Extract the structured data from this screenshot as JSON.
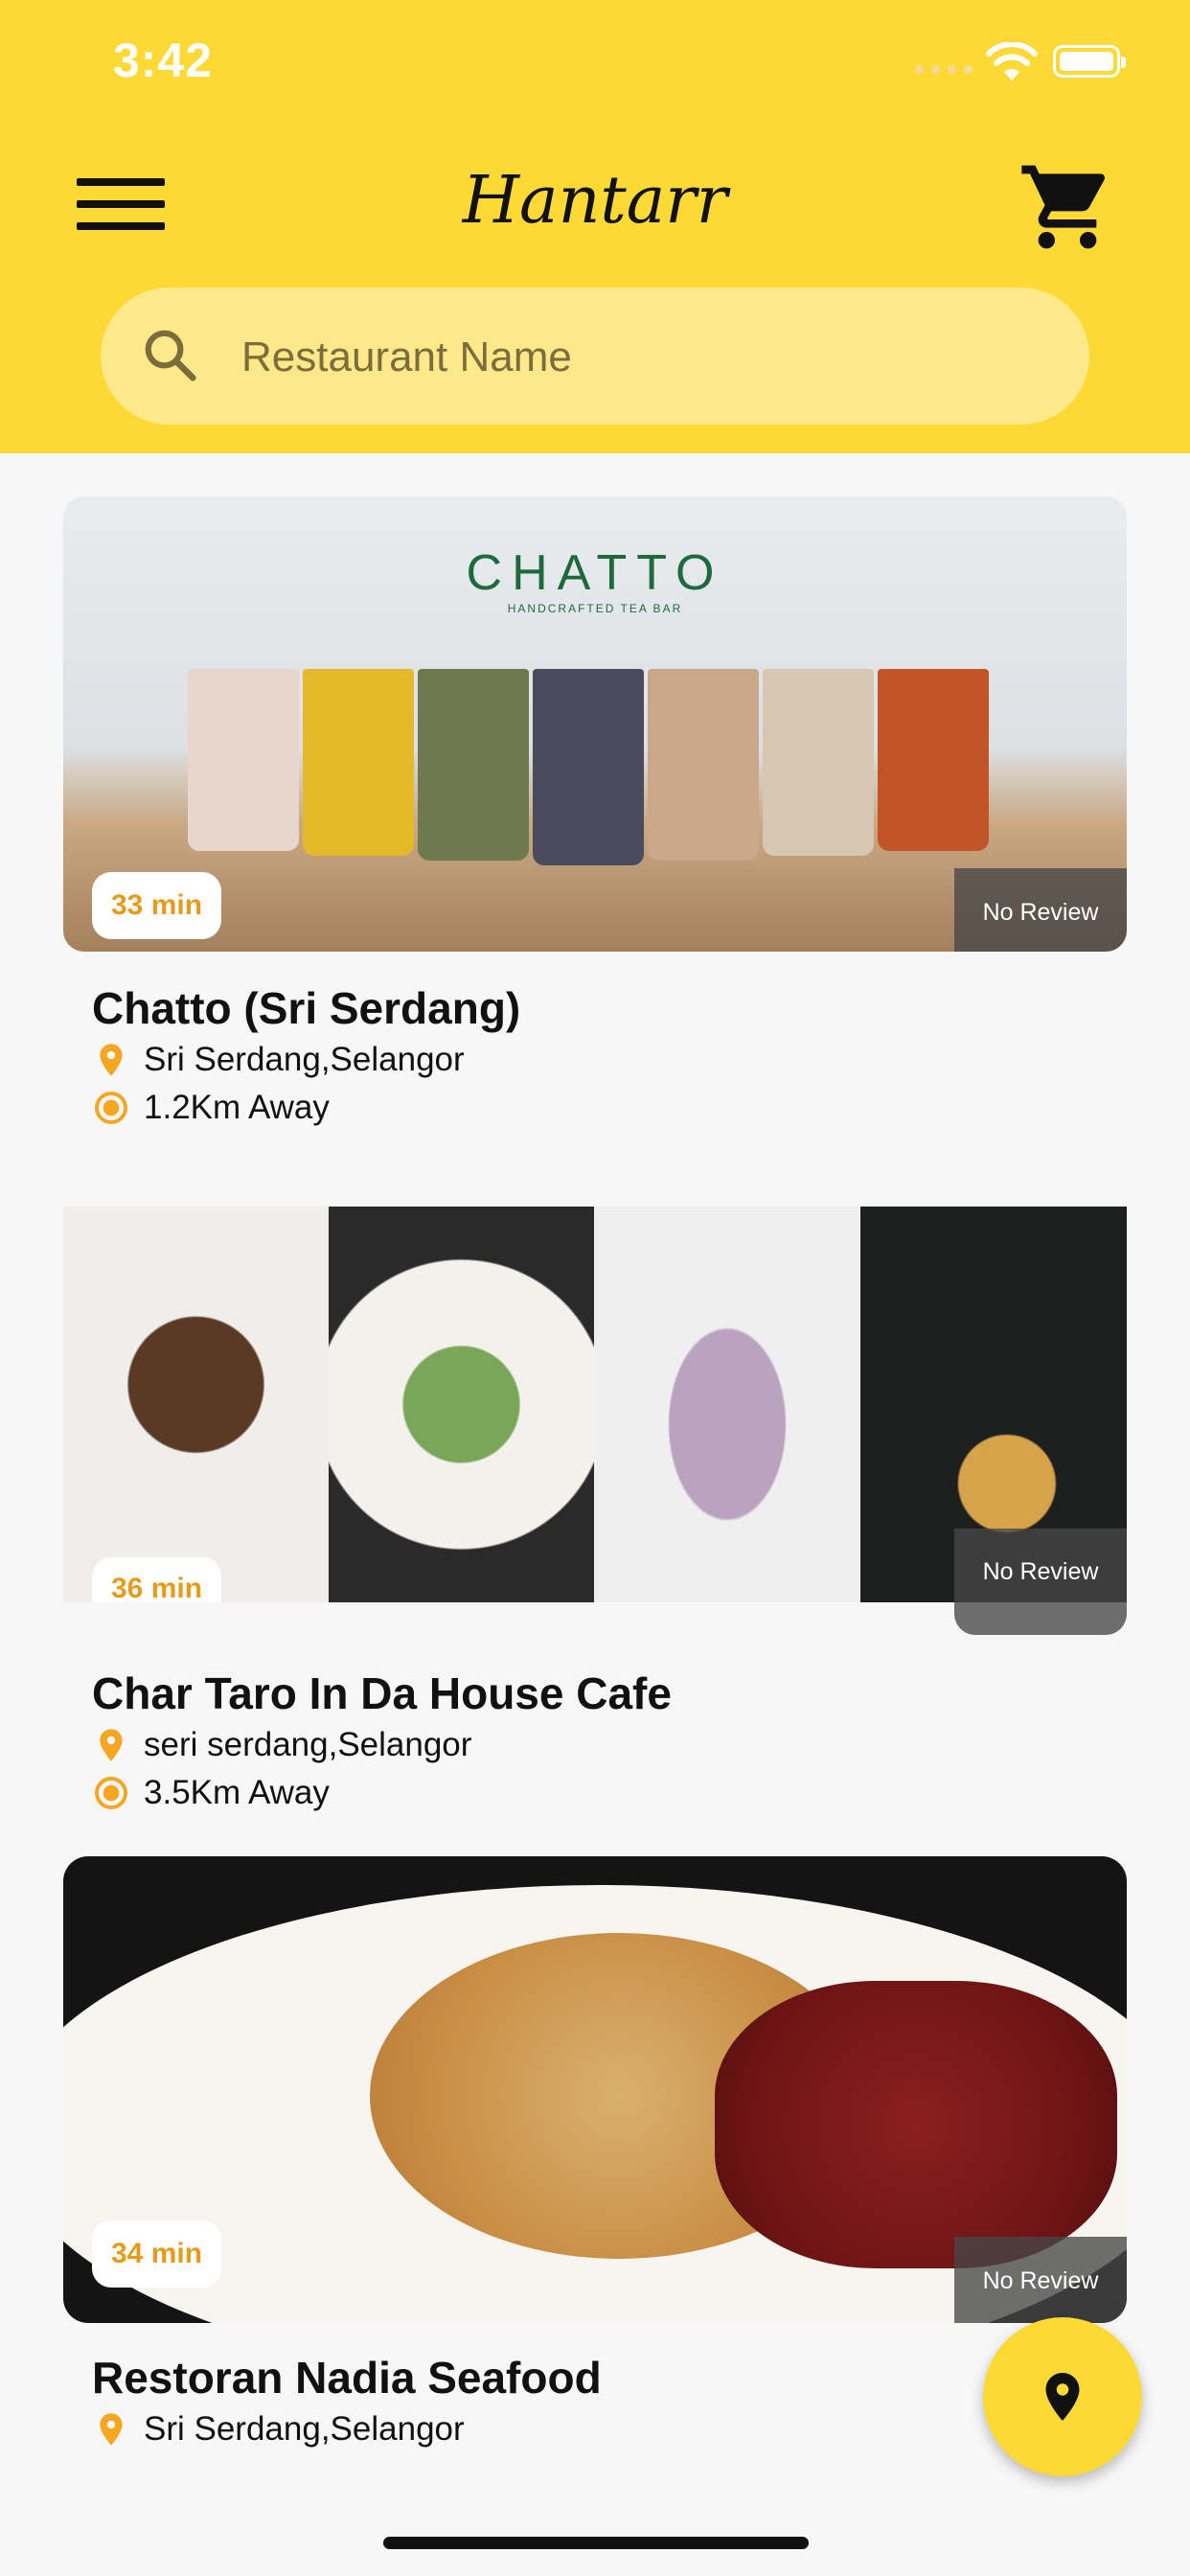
{
  "status_bar": {
    "time": "3:42"
  },
  "header": {
    "brand": "Hantarr",
    "search": {
      "placeholder": "Restaurant Name",
      "value": ""
    }
  },
  "restaurants": [
    {
      "name": "Chatto (Sri Serdang)",
      "location": "Sri Serdang,Selangor",
      "distance": "1.2Km Away",
      "eta": "33 min",
      "review": "No Review",
      "image_logo_text": "CHATTO",
      "image_sub_text": "HANDCRAFTED TEA BAR"
    },
    {
      "name": "Char Taro In Da House Cafe",
      "location": "seri serdang,Selangor",
      "distance": "3.5Km Away",
      "eta": "36 min",
      "review": "No Review"
    },
    {
      "name": "Restoran Nadia Seafood",
      "location": "Sri Serdang,Selangor",
      "eta": "34 min",
      "review": "No Review"
    }
  ],
  "colors": {
    "accent": "#fdd935",
    "badge_text": "#e79b1b",
    "pin": "#f5a623"
  }
}
